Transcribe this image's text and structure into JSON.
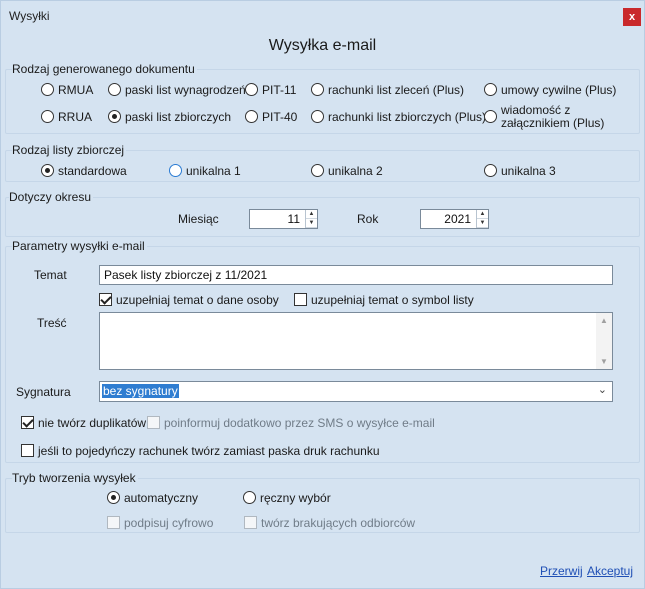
{
  "window": {
    "title": "Wysyłki",
    "close_label": "x"
  },
  "main_title": "Wysyłka e-mail",
  "doc_type": {
    "legend": "Rodzaj generowanego dokumentu",
    "options": [
      "RMUA",
      "paski list wynagrodzeń",
      "PIT-11",
      "rachunki list zleceń (Plus)",
      "umowy cywilne (Plus)",
      "RRUA",
      "paski list zbiorczych",
      "PIT-40",
      "rachunki list zbiorczych (Plus)",
      "wiadomość z",
      "załącznikiem (Plus)"
    ],
    "selected": "paski list zbiorczych"
  },
  "list_type": {
    "legend": "Rodzaj listy zbiorczej",
    "options": [
      "standardowa",
      "unikalna 1",
      "unikalna 2",
      "unikalna 3"
    ],
    "selected": "standardowa"
  },
  "period": {
    "legend": "Dotyczy okresu",
    "month_label": "Miesiąc",
    "month_value": "11",
    "year_label": "Rok",
    "year_value": "2021"
  },
  "email_params": {
    "legend": "Parametry wysyłki e-mail",
    "subject_label": "Temat",
    "subject_value": "Pasek listy zbiorczej z 11/2021",
    "fill_person_label": "uzupełniaj temat o dane osoby",
    "fill_person_checked": true,
    "fill_symbol_label": "uzupełniaj temat o symbol listy",
    "fill_symbol_checked": false,
    "body_label": "Treść",
    "body_value": "",
    "signature_label": "Sygnatura",
    "signature_value": "bez sygnatury",
    "no_duplicates_label": "nie twórz duplikatów",
    "no_duplicates_checked": true,
    "sms_label": "poinformuj dodatkowo przez SMS o wysyłce e-mail",
    "sms_checked": false,
    "single_bill_label": "jeśli to pojedyńczy rachunek twórz zamiast paska druk rachunku",
    "single_bill_checked": false
  },
  "mode": {
    "legend": "Tryb tworzenia wysyłek",
    "auto_label": "automatyczny",
    "manual_label": "ręczny wybór",
    "selected": "automatyczny",
    "sign_label": "podpisuj cyfrowo",
    "missing_label": "twórz brakujących odbiorców"
  },
  "footer": {
    "cancel_label": "Przerwij",
    "accept_label": "Akceptuj"
  }
}
